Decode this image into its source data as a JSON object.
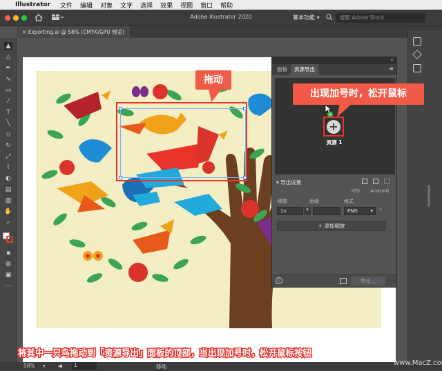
{
  "menubar": {
    "app_name": "Illustrator",
    "items": [
      "文件",
      "编辑",
      "对象",
      "文字",
      "选择",
      "效果",
      "视图",
      "窗口",
      "帮助"
    ]
  },
  "titlebar": {
    "title": "Adobe Illustrator 2020",
    "workspace": "基本功能",
    "search_placeholder": "搜索 Adobe Stock"
  },
  "document_tab": {
    "label": "Exporting.ai @ 58% (CMYK/GPU 预览)",
    "close": "×"
  },
  "assets_panel": {
    "tabs": [
      "画板",
      "资源导出"
    ],
    "asset_name": "资源 1",
    "add_glyph": "+",
    "export_settings_title": "导出设置",
    "ios_label": "iOS",
    "android_label": "Android",
    "col_scale": "缩放",
    "col_suffix": "后缀",
    "col_format": "格式",
    "scale_value": "1x",
    "format_value": "PNG",
    "add_scale_label": "+ 添加缩放",
    "export_button": "导出..."
  },
  "statusbar": {
    "zoom": "58%",
    "page": "1",
    "tool": "移动"
  },
  "annotations": {
    "drag_label": "拖动",
    "release_label": "出现加号时，松开鼠标",
    "caption": "将其中一只鸟拖动到「资源导出」面板的顶部，当出现加号时，松开鼠标按钮",
    "watermark": "www.MacZ.com"
  },
  "colors": {
    "callout_red": "#f05a46",
    "highlight_red": "#e8332a",
    "ui_dark": "#535353",
    "artboard_cream": "#f4eec5"
  }
}
